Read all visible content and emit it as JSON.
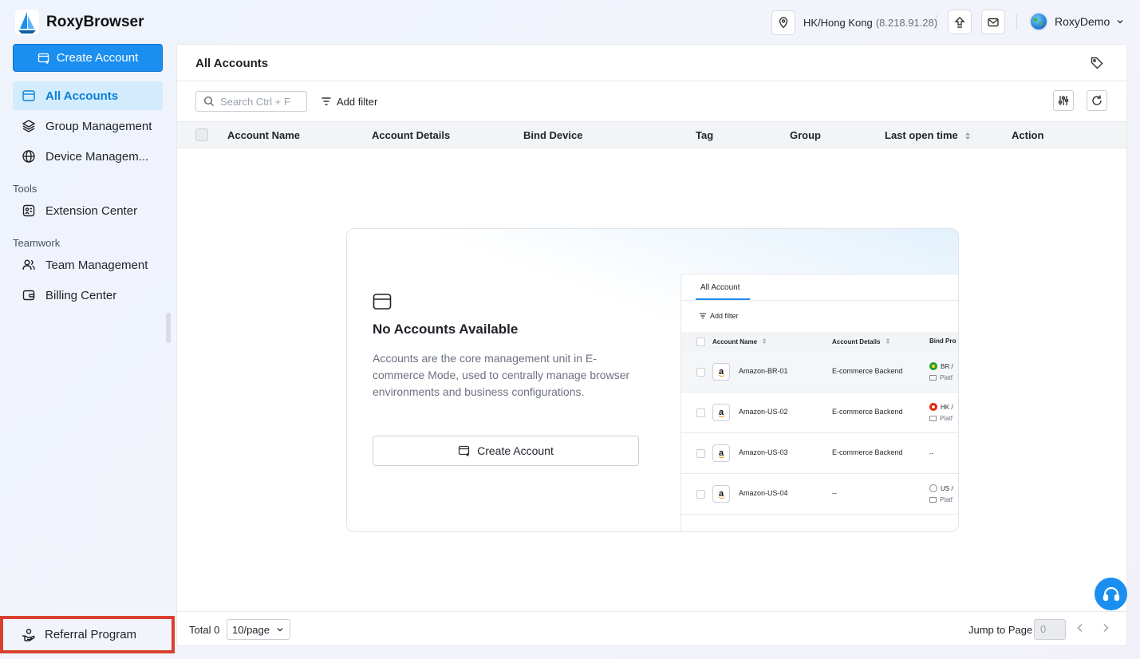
{
  "app": {
    "brand": "RoxyBrowser"
  },
  "header": {
    "location": "HK/Hong Kong",
    "ip": "(8.218.91.28)",
    "user_name": "RoxyDemo"
  },
  "sidebar": {
    "create_button": "Create Account",
    "items": [
      {
        "label": "All Accounts"
      },
      {
        "label": "Group Management"
      },
      {
        "label": "Device Managem..."
      }
    ],
    "tools_title": "Tools",
    "tools_items": [
      {
        "label": "Extension Center"
      }
    ],
    "teamwork_title": "Teamwork",
    "teamwork_items": [
      {
        "label": "Team Management"
      },
      {
        "label": "Billing Center"
      }
    ],
    "referral": "Referral Program"
  },
  "main": {
    "title": "All Accounts",
    "search_placeholder": "Search Ctrl + F",
    "add_filter": "Add filter",
    "columns": [
      "Account Name",
      "Account Details",
      "Bind Device",
      "Tag",
      "Group",
      "Last open time",
      "Action"
    ]
  },
  "empty": {
    "title": "No Accounts Available",
    "description": "Accounts are the core management unit in E-commerce Mode, used to centrally manage browser environments and business configurations.",
    "button": "Create Account"
  },
  "preview": {
    "tab": "All Account",
    "add_filter": "Add filter",
    "columns": [
      "Account Name",
      "Account Details",
      "Bind Pro"
    ],
    "rows": [
      {
        "name": "Amazon-BR-01",
        "details": "E-commerce Backend",
        "bind1": "BR /",
        "bind2": "Platf"
      },
      {
        "name": "Amazon-US-02",
        "details": "E-commerce Backend",
        "bind1": "HK /",
        "bind2": "Platf"
      },
      {
        "name": "Amazon-US-03",
        "details": "E-commerce Backend",
        "bind1": "--",
        "bind2": ""
      },
      {
        "name": "Amazon-US-04",
        "details": "--",
        "bind1": "US /",
        "bind2": "Platf"
      }
    ]
  },
  "footer": {
    "total": "Total 0",
    "page_size": "10/page",
    "jump_label": "Jump to Page",
    "jump_value": "0"
  },
  "colors": {
    "accent": "#1a8ff0",
    "highlight": "#d9412e",
    "active_bg": "#d3ecfd"
  }
}
